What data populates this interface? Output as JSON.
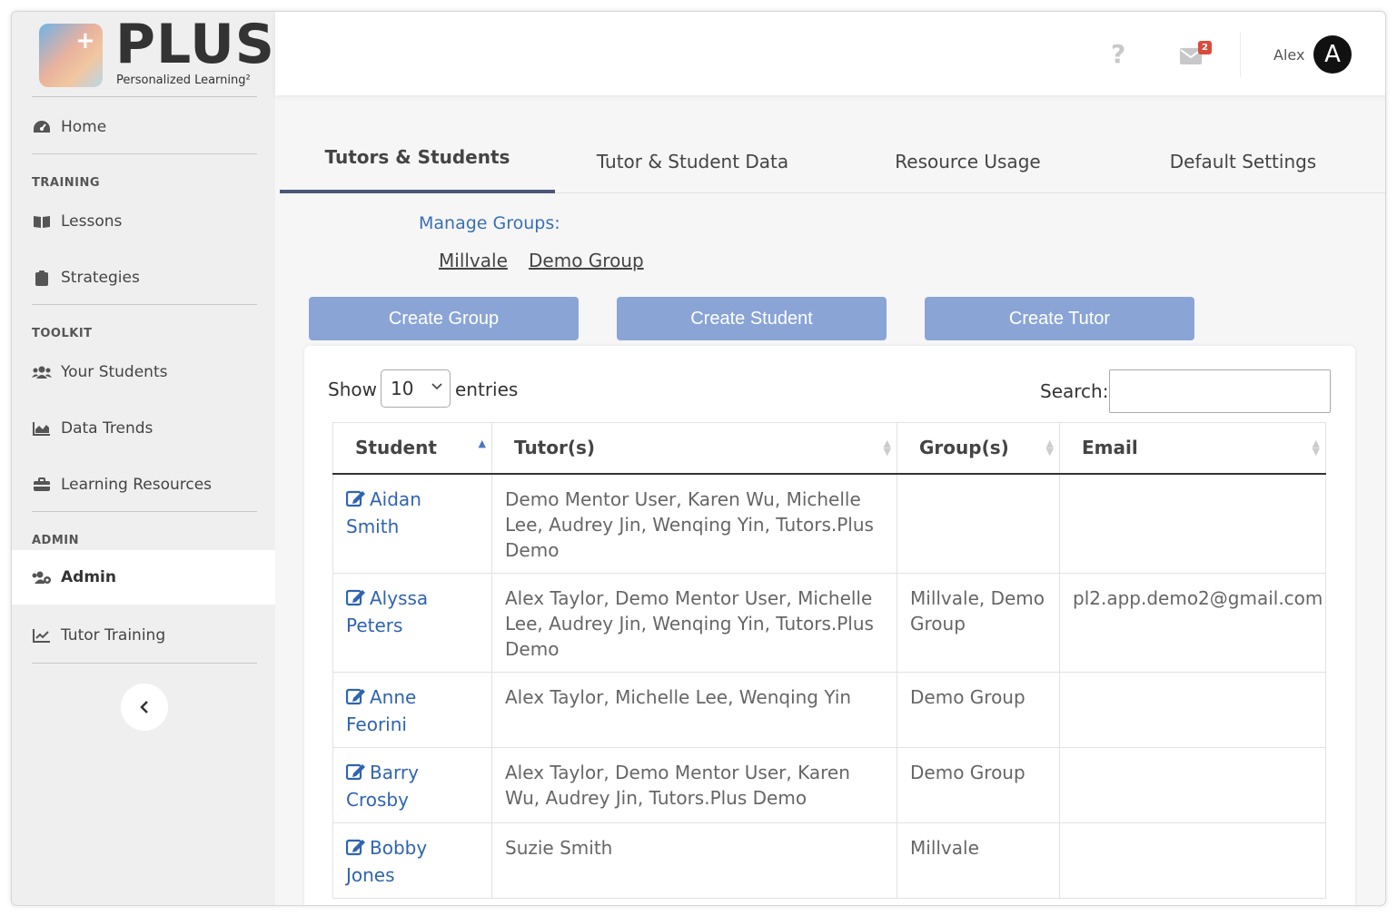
{
  "brand": {
    "name": "PLUS",
    "tagline": "Personalized Learning²"
  },
  "sidebar": {
    "home": "Home",
    "sections": {
      "training": "TRAINING",
      "toolkit": "TOOLKIT",
      "admin": "ADMIN"
    },
    "items": {
      "lessons": "Lessons",
      "strategies": "Strategies",
      "your_students": "Your Students",
      "data_trends": "Data Trends",
      "learning_resources": "Learning Resources",
      "admin": "Admin",
      "tutor_training": "Tutor Training"
    },
    "collapse_icon": "chevron-left-icon"
  },
  "header": {
    "help": "?",
    "mail_badge": "2",
    "user_name": "Alex",
    "avatar_letter": "A"
  },
  "tabs": [
    "Tutors & Students",
    "Tutor & Student Data",
    "Resource Usage",
    "Default Settings"
  ],
  "manage_groups": {
    "label": "Manage Groups:",
    "groups": [
      "Millvale",
      "Demo Group"
    ]
  },
  "actions": {
    "create_group": "Create Group",
    "create_student": "Create Student",
    "create_tutor": "Create Tutor"
  },
  "table_controls": {
    "show": "Show",
    "entries_value": "10",
    "entries": "entries",
    "search": "Search:"
  },
  "table": {
    "headers": [
      "Student",
      "Tutor(s)",
      "Group(s)",
      "Email"
    ],
    "rows": [
      {
        "student": "Aidan Smith",
        "tutors": "Demo Mentor User, Karen Wu, Michelle Lee, Audrey Jin, Wenqing Yin, Tutors.Plus Demo",
        "groups": "",
        "email": ""
      },
      {
        "student": "Alyssa Peters",
        "tutors": "Alex Taylor, Demo Mentor User, Michelle Lee, Audrey Jin, Wenqing Yin, Tutors.Plus Demo",
        "groups": "Millvale, Demo Group",
        "email": "pl2.app.demo2@gmail.com"
      },
      {
        "student": "Anne Feorini",
        "tutors": "Alex Taylor, Michelle Lee, Wenqing Yin",
        "groups": "Demo Group",
        "email": ""
      },
      {
        "student": "Barry Crosby",
        "tutors": "Alex Taylor, Demo Mentor User, Karen Wu, Audrey Jin, Tutors.Plus Demo",
        "groups": "Demo Group",
        "email": ""
      },
      {
        "student": "Bobby Jones",
        "tutors": "Suzie Smith",
        "groups": "Millvale",
        "email": ""
      }
    ]
  },
  "colors": {
    "accent_link": "#2f64b1",
    "button": "#8aa4d6",
    "tab_underline": "#4b5778",
    "badge": "#d94b3d"
  }
}
